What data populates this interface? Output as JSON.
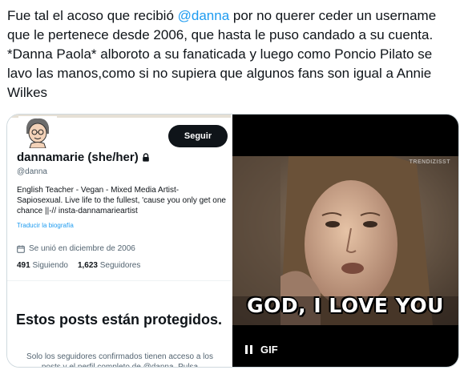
{
  "tweet": {
    "text_before_mention": "Fue tal el acoso que recibió ",
    "mention": "@danna",
    "text_after_mention": " por no querer ceder un username que le pertenece desde 2006, que hasta le puso candado a su cuenta. *Danna Paola* alboroto a su fanaticada y luego como Poncio Pilato se lavo las manos,como si no supiera que algunos fans son igual a Annie Wilkes",
    "accent_color": "#1d9bf0"
  },
  "profile": {
    "follow_button": "Seguir",
    "display_name": "dannamarie (she/her)",
    "handle": "@danna",
    "bio": "English Teacher - Vegan - Mixed Media Artist- Sapiosexual. Live life to the fullest, 'cause you only get one chance ||-// insta-dannamarieartist",
    "translate_bio": "Traducir la biografía",
    "joined": "Se unió en diciembre de 2006",
    "following_count": "491",
    "following_label": "Siguiendo",
    "followers_count": "1,623",
    "followers_label": "Seguidores",
    "protected_title": "Estos posts están protegidos.",
    "protected_body": "Solo los seguidores confirmados tienen acceso a los posts y el perfil completo de @danna. Pulsa"
  },
  "gif": {
    "watermark": "TRENDIZISST",
    "caption": "GOD, I LOVE YOU",
    "badge": "GIF",
    "control_icon": "pause-icon"
  }
}
